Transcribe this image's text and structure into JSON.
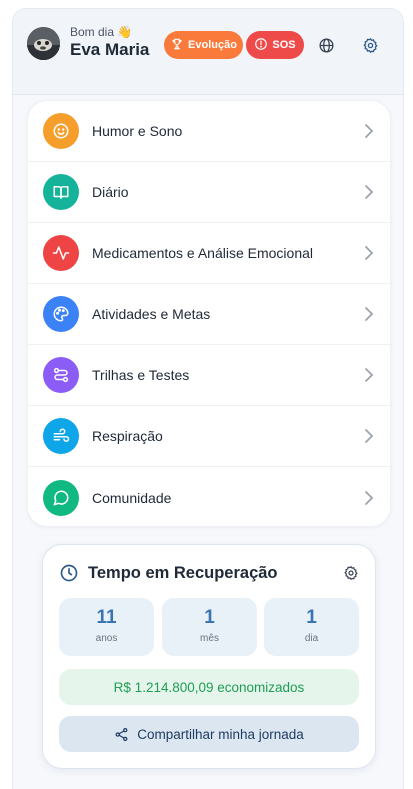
{
  "header": {
    "greeting": "Bom dia",
    "greeting_emoji": "👋",
    "user_name": "Eva Maria",
    "evolution_label": "Evolução",
    "sos_label": "SOS",
    "icons": [
      "trophy-icon",
      "alert-circle-icon",
      "globe-icon",
      "gear-icon"
    ]
  },
  "menu": {
    "items": [
      {
        "label": "Humor e Sono",
        "icon": "smile-icon",
        "color": "#f59e2b"
      },
      {
        "label": "Diário",
        "icon": "book-icon",
        "color": "#14b39a"
      },
      {
        "label": "Medicamentos e Análise Emocional",
        "icon": "activity-icon",
        "color": "#ef4444"
      },
      {
        "label": "Atividades e Metas",
        "icon": "palette-icon",
        "color": "#3b82f6"
      },
      {
        "label": "Trilhas e Testes",
        "icon": "route-icon",
        "color": "#8b5cf6"
      },
      {
        "label": "Respiração",
        "icon": "wind-icon",
        "color": "#0ea5e9"
      },
      {
        "label": "Comunidade",
        "icon": "message-circle-icon",
        "color": "#10b981"
      }
    ]
  },
  "recovery": {
    "title": "Tempo em Recuperação",
    "years_value": "11",
    "years_label": "anos",
    "months_value": "1",
    "months_label": "mês",
    "days_value": "1",
    "days_label": "dia",
    "savings_text": "R$ 1.214.800,09 economizados",
    "share_label": "Compartilhar minha jornada",
    "accent_color": "#3b74b4",
    "savings_color": "#1f9d55"
  }
}
